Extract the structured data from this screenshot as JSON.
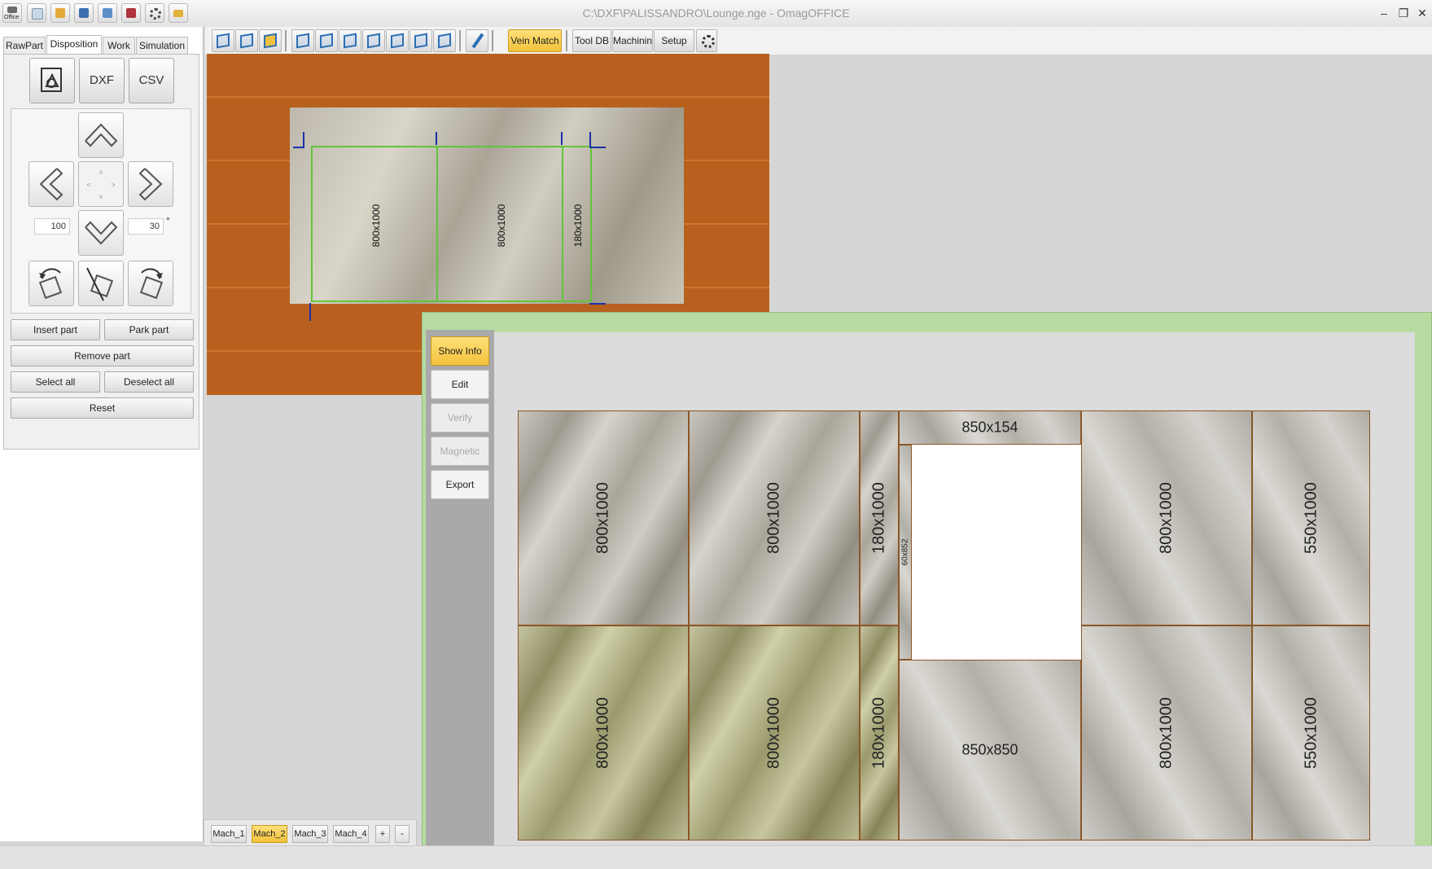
{
  "window": {
    "title": "C:\\DXF\\PALISSANDRO\\Lounge.nge - OmagOFFICE",
    "logo_label": "Office",
    "controls": {
      "minimize": "–",
      "restore": "❐",
      "close": "✕"
    }
  },
  "quick_access": [
    {
      "name": "office-logo-icon",
      "color": "#6b6b6b"
    },
    {
      "name": "new-file-icon",
      "color": "#c9d7e6"
    },
    {
      "name": "open-folder-icon",
      "color": "#e2a93a"
    },
    {
      "name": "save-icon",
      "color": "#3a6fb0"
    },
    {
      "name": "save-as-icon",
      "color": "#3a6fb0"
    },
    {
      "name": "save-all-icon",
      "color": "#b0323a"
    },
    {
      "name": "settings-gear-icon",
      "color": "#555555"
    },
    {
      "name": "email-icon",
      "color": "#e3b23c"
    }
  ],
  "toolbar": {
    "view_icons": [
      "view-top-icon",
      "view-front-icon",
      "view-3d-icon",
      "view-left-icon",
      "view-right-icon",
      "view-back-icon",
      "view-iso1-icon",
      "view-iso2-icon",
      "view-iso3-icon",
      "view-iso4-icon"
    ],
    "measure_icon": "ruler-icon",
    "vein_match": "Vein Match",
    "tool_db": "Tool DB",
    "machining": "Machining",
    "setup": "Setup",
    "settings_icon": "gear-icon"
  },
  "left_panel": {
    "tabs": [
      "RawPart",
      "Disposition",
      "Work",
      "Simulation"
    ],
    "active_tab": "Disposition",
    "import_buttons": {
      "shape": "shape-import-icon",
      "dxf": "DXF",
      "csv": "CSV"
    },
    "step_value": "100",
    "angle_value": "30",
    "angle_unit": "°",
    "insert_part": "Insert part",
    "park_part": "Park part",
    "remove_part": "Remove part",
    "select_all": "Select all",
    "deselect_all": "Deselect all",
    "reset": "Reset"
  },
  "machine_view": {
    "parts": [
      "800x1000",
      "800x1000",
      "180x1000"
    ]
  },
  "vein_match_dialog": {
    "side_buttons": {
      "show_info": "Show Info",
      "edit": "Edit",
      "verify": "Verify",
      "magnetic": "Magnetic",
      "export": "Export"
    },
    "pieces": {
      "p1": "800x1000",
      "p2": "800x1000",
      "p3": "180x1000",
      "p4": "850x154",
      "p5": "60x852",
      "p6": "800x1000",
      "p7": "550x1000",
      "p8": "800x1000",
      "p9": "800x1000",
      "p10": "180x1000",
      "p11": "850x850",
      "p12": "800x1000",
      "p13": "550x1000"
    }
  },
  "machine_tabs": [
    "Mach_1",
    "Mach_2",
    "Mach_3",
    "Mach_4",
    "+",
    "-"
  ],
  "active_machine": "Mach_2"
}
